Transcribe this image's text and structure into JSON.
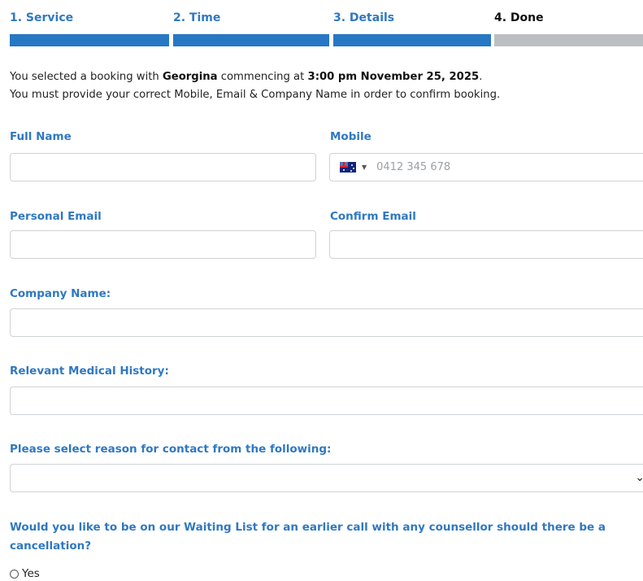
{
  "steps": [
    {
      "label": "1. Service",
      "state": "complete"
    },
    {
      "label": "2. Time",
      "state": "complete"
    },
    {
      "label": "3. Details",
      "state": "complete"
    },
    {
      "label": "4. Done",
      "state": "pending"
    }
  ],
  "intro": {
    "line1_prefix": "You selected a booking with ",
    "counsellor": "Georgina",
    "line1_mid": " commencing at ",
    "datetime": "3:00 pm November 25, 2025",
    "line1_suffix": ".",
    "line2": "You must provide your correct Mobile, Email & Company Name in order to confirm booking."
  },
  "form": {
    "full_name": {
      "label": "Full Name",
      "value": ""
    },
    "mobile": {
      "label": "Mobile",
      "placeholder": "0412 345 678",
      "country_icon": "australia-flag-icon"
    },
    "personal_email": {
      "label": "Personal Email",
      "value": ""
    },
    "confirm_email": {
      "label": "Confirm Email",
      "value": ""
    },
    "company_name": {
      "label": "Company Name:",
      "value": ""
    },
    "medical_history": {
      "label": "Relevant Medical History:",
      "value": ""
    },
    "reason": {
      "label": "Please select reason for contact from the following:",
      "selected": ""
    },
    "waiting_list": {
      "question": "Would you like to be on our Waiting List for an earlier call with any counsellor should there be a cancellation?",
      "options": [
        "Yes"
      ]
    }
  },
  "colors": {
    "accent": "#2677c4",
    "label": "#2f78c2",
    "pending": "#bcbfc2"
  }
}
